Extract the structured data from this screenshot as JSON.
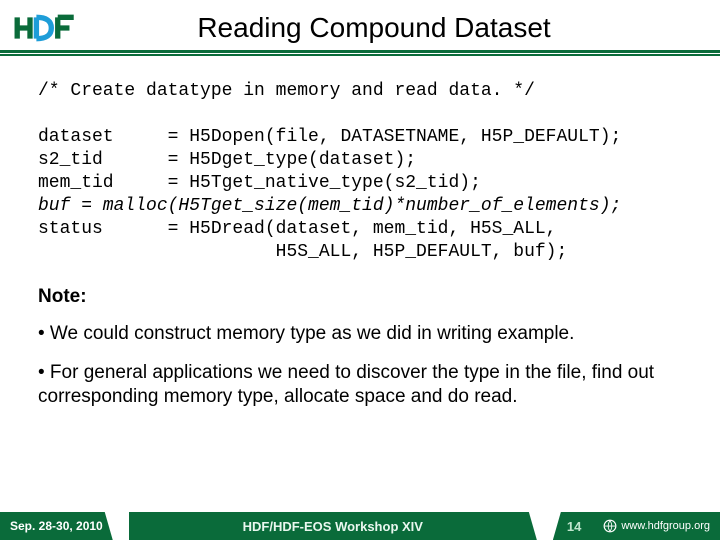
{
  "header": {
    "title": "Reading Compound Dataset",
    "logo_text": "HDF"
  },
  "code": {
    "comment": "/* Create datatype in memory and read data. */",
    "l1": "dataset     = H5Dopen(file, DATASETNAME, H5P_DEFAULT);",
    "l2": "s2_tid      = H5Dget_type(dataset);",
    "l3": "mem_tid     = H5Tget_native_type(s2_tid);",
    "l4": "buf = malloc(H5Tget_size(mem_tid)*number_of_elements);",
    "l5": "status      = H5Dread(dataset, mem_tid, H5S_ALL,",
    "l6": "                      H5S_ALL, H5P_DEFAULT, buf);"
  },
  "notes": {
    "heading": "Note:",
    "p1": "• We could construct memory type as we did in writing example.",
    "p2": "• For general applications we need to discover the type in the file, find out corresponding memory type, allocate space and do read."
  },
  "footer": {
    "date": "Sep. 28-30, 2010",
    "venue": "HDF/HDF-EOS Workshop XIV",
    "page": "14",
    "org": "www.hdfgroup.org"
  }
}
